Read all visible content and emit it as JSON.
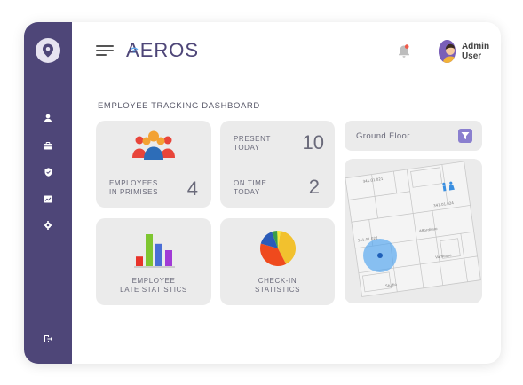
{
  "header": {
    "brand_a": "A",
    "brand_rest": "EROS",
    "user_name": "Admin User"
  },
  "page": {
    "title": "EMPLOYEE TRACKING DASHBOARD"
  },
  "tiles": {
    "in_premises": {
      "label_line1": "EMPLOYEES",
      "label_line2": "IN PRIMISES",
      "value": "4"
    },
    "present_today": {
      "label_line1": "PRESENT",
      "label_line2": "TODAY",
      "value": "10"
    },
    "on_time_today": {
      "label_line1": "ON TIME",
      "label_line2": "TODAY",
      "value": "2"
    },
    "late_stats": {
      "label_line1": "EMPLOYEE",
      "label_line2": "LATE STATISTICS"
    },
    "checkin_stats": {
      "label_line1": "CHECK-IN",
      "label_line2": "STATISTICS"
    }
  },
  "floor": {
    "selected": "Ground Floor"
  },
  "map_labels": [
    "341.01.021",
    "341.01.024",
    "341.01.022",
    "Affordiduo",
    "Varhouse",
    "Studio"
  ],
  "colors": {
    "sidebar": "#4e4678",
    "brand": "#4e4678",
    "accent": "#8a7fcf",
    "tile_bg": "#ebebeb",
    "beacon": "#4da3ef"
  },
  "icons": [
    "location-pin-icon",
    "user-icon",
    "briefcase-icon",
    "shield-icon",
    "chart-icon",
    "gear-icon",
    "logout-icon",
    "bell-icon",
    "chevron-down-icon",
    "filter-icon"
  ],
  "late_chart": {
    "type": "bar",
    "values": [
      0.3,
      1.0,
      0.7,
      0.5
    ],
    "colors": [
      "#e8332a",
      "#7ec630",
      "#4a6ed6",
      "#a13ad6"
    ]
  },
  "checkin_chart": {
    "type": "pie",
    "slices": [
      {
        "value": 40,
        "color": "#f2c12e"
      },
      {
        "value": 37,
        "color": "#ef4a1d"
      },
      {
        "value": 15,
        "color": "#2a5bb8"
      },
      {
        "value": 5,
        "color": "#3a9d4a"
      },
      {
        "value": 3,
        "color": "#f5e83a"
      }
    ]
  }
}
